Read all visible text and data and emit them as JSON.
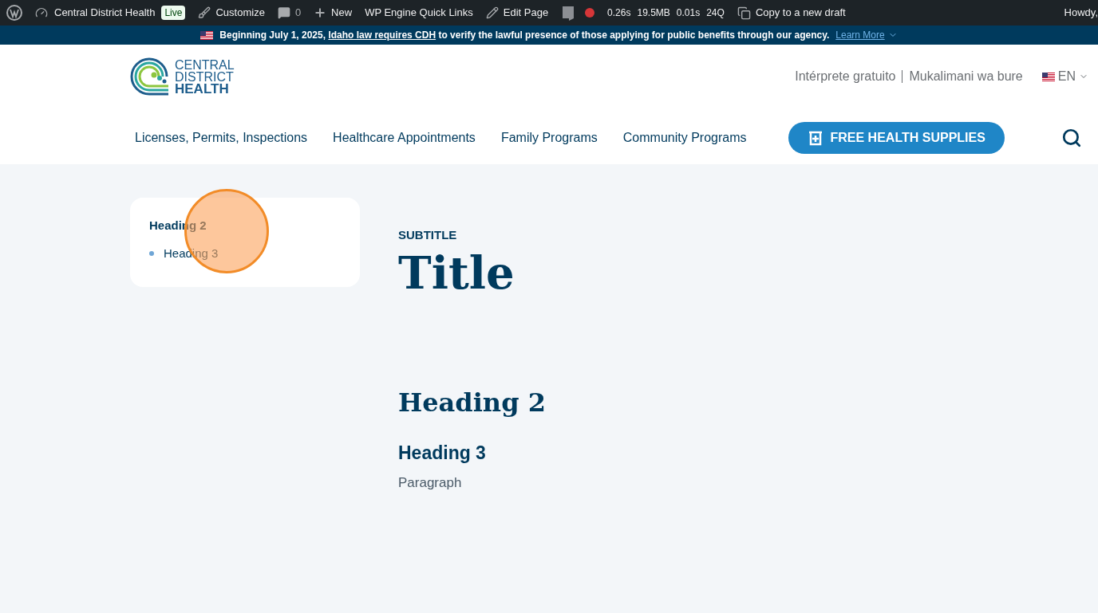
{
  "admin_bar": {
    "site_name": "Central District Health",
    "live_badge": "Live",
    "customize": "Customize",
    "comments_count": "0",
    "new": "New",
    "quick_links": "WP Engine Quick Links",
    "edit_page": "Edit Page",
    "stats": [
      "0.26s",
      "19.5MB",
      "0.01s",
      "24Q"
    ],
    "copy_draft": "Copy to a new draft",
    "greeting": "Howdy,"
  },
  "notice": {
    "text_before": "Beginning July 1, 2025,",
    "link": "Idaho law requires CDH",
    "text_after": "to verify the lawful presence of those applying for public benefits through our agency.",
    "learn_more": "Learn More"
  },
  "logo": {
    "lines": [
      "CENTRAL",
      "DISTRICT",
      "HEALTH"
    ]
  },
  "utility_links": [
    "Intérprete gratuito",
    "Mukalimani wa bure"
  ],
  "language": "EN",
  "nav": [
    "Licenses, Permits, Inspections",
    "Healthcare Appointments",
    "Family Programs",
    "Community Programs"
  ],
  "cta_button": "FREE HEALTH SUPPLIES",
  "toc": {
    "heading": "Heading 2",
    "items": [
      "Heading 3"
    ]
  },
  "content": {
    "subtitle": "SUBTITLE",
    "title": "Title",
    "heading_2": "Heading 2",
    "heading_3": "Heading 3",
    "paragraph": "Paragraph"
  },
  "click_indicator": {
    "kind": "circle"
  }
}
